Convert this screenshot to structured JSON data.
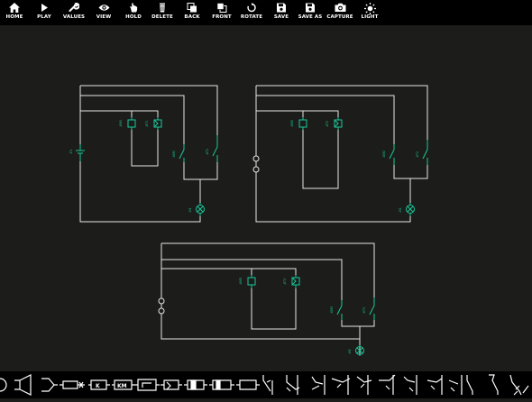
{
  "toolbar": {
    "buttons": [
      {
        "label": "HOME",
        "icon": "home-icon"
      },
      {
        "label": "PLAY",
        "icon": "play-icon"
      },
      {
        "label": "VALUES",
        "icon": "wrench-icon"
      },
      {
        "label": "VIEW",
        "icon": "eye-icon"
      },
      {
        "label": "HOLD",
        "icon": "hand-icon"
      },
      {
        "label": "DELETE",
        "icon": "trash-icon"
      },
      {
        "label": "BACK",
        "icon": "send-back-icon"
      },
      {
        "label": "FRONT",
        "icon": "bring-front-icon"
      },
      {
        "label": "ROTATE",
        "icon": "rotate-icon"
      },
      {
        "label": "SAVE",
        "icon": "save-icon"
      },
      {
        "label": "SAVE AS",
        "icon": "save-as-icon"
      },
      {
        "label": "CAPTURE",
        "icon": "camera-icon"
      },
      {
        "label": "LIGHT",
        "icon": "sun-icon"
      }
    ]
  },
  "circuits": {
    "c1": {
      "battery": "-P1",
      "coil1": "-KM1",
      "coil2": "-KT1",
      "switch1": "-KM1",
      "switch2": "-KT1",
      "lamp": "-H1"
    },
    "c2": {
      "coil1": "-KM2",
      "coil2": "-KT2",
      "switch1": "-KM2",
      "switch2": "-KT2",
      "lamp": "-H2"
    },
    "c3": {
      "coil1": "-KM3",
      "coil2": "-KT3",
      "switch1": "-KM3",
      "switch2": "-KT3",
      "lamp": "-H3"
    }
  },
  "palette": {
    "relay_label": "K",
    "contactor_label": "KM",
    "items": [
      "lamp-symbol",
      "horn-symbol",
      "buzzer-symbol",
      "fuse-symbol",
      "relay-k",
      "contactor-km",
      "timer-relay",
      "coil-a",
      "coil-b",
      "coil-c",
      "coil-d",
      "no-contact",
      "nc-contact",
      "changeover-contact",
      "time-contact-a",
      "time-contact-b",
      "time-contact-c",
      "pushbutton-no",
      "pushbutton-nc",
      "pushbutton-co",
      "switch-a",
      "switch-b",
      "switch-c"
    ]
  },
  "colors": {
    "toolbar_bg": "#000000",
    "canvas_bg": "#1c1d1a",
    "wire": "#e6e6e6",
    "component": "#18c79a"
  }
}
